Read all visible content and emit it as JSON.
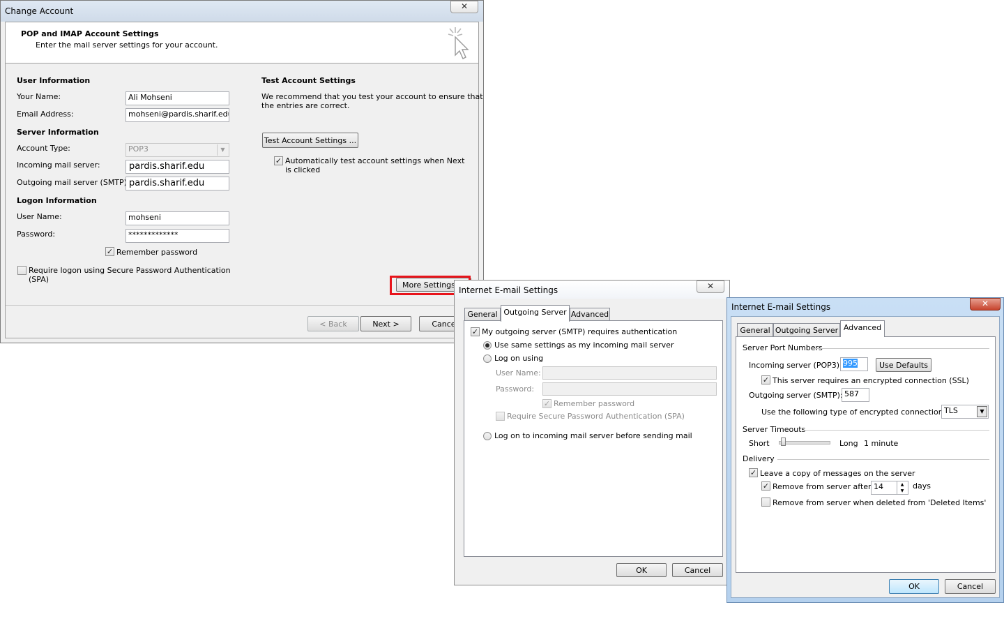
{
  "change_account": {
    "title": "Change Account",
    "close_glyph": "✕",
    "header_title": "POP and IMAP Account Settings",
    "header_subtitle": "Enter the mail server settings for your account.",
    "header_icon": "cursor-sparkle-icon",
    "user_info": {
      "heading": "User Information",
      "name_label": "Your Name:",
      "name_value": "Ali Mohseni",
      "email_label": "Email Address:",
      "email_value": "mohseni@pardis.sharif.edu"
    },
    "server_info": {
      "heading": "Server Information",
      "account_type_label": "Account Type:",
      "account_type_value": "POP3",
      "incoming_label": "Incoming mail server:",
      "incoming_value": "pardis.sharif.edu",
      "outgoing_label": "Outgoing mail server (SMTP):",
      "outgoing_value": "pardis.sharif.edu"
    },
    "logon_info": {
      "heading": "Logon Information",
      "username_label": "User Name:",
      "username_value": "mohseni",
      "password_label": "Password:",
      "password_value": "*************",
      "remember_label": "Remember password",
      "remember_checked": true,
      "spa_label_line1": "Require logon using Secure Password Authentication",
      "spa_label_line2": "(SPA)",
      "spa_checked": false
    },
    "test_settings": {
      "heading": "Test Account Settings",
      "desc_line1": "We recommend that you test your account to ensure that",
      "desc_line2": "the entries are correct.",
      "test_button": "Test Account Settings ...",
      "auto_test_line1": "Automatically test account settings when Next",
      "auto_test_line2": "is clicked",
      "auto_test_checked": true
    },
    "more_settings_button": "More Settings ...",
    "highlight_color": "#e8141b",
    "back_button": "< Back",
    "next_button": "Next >",
    "cancel_button": "Cancel"
  },
  "outgoing_dialog": {
    "title": "Internet E-mail Settings",
    "close_glyph": "✕",
    "tabs": [
      "General",
      "Outgoing Server",
      "Advanced"
    ],
    "selected_tab": "Outgoing Server",
    "smtp_auth_label": "My outgoing server (SMTP) requires authentication",
    "smtp_auth_checked": true,
    "same_settings_label": "Use same settings as my incoming mail server",
    "log_on_using_label": "Log on using",
    "username_label": "User Name:",
    "username_value": "",
    "password_label": "Password:",
    "password_value": "",
    "remember_label": "Remember password",
    "spa_label": "Require Secure Password Authentication (SPA)",
    "log_on_incoming_label": "Log on to incoming mail server before sending mail",
    "ok_button": "OK",
    "cancel_button": "Cancel"
  },
  "advanced_dialog": {
    "title": "Internet E-mail Settings",
    "close_glyph": "✕",
    "tabs": [
      "General",
      "Outgoing Server",
      "Advanced"
    ],
    "selected_tab": "Advanced",
    "ports_heading": "Server Port Numbers",
    "incoming_label": "Incoming server (POP3):",
    "incoming_value": "995",
    "use_defaults_button": "Use Defaults",
    "ssl_label": "This server requires an encrypted connection (SSL)",
    "ssl_checked": true,
    "outgoing_label": "Outgoing server (SMTP):",
    "outgoing_value": "587",
    "encryption_label": "Use the following type of encrypted connection:",
    "encryption_value": "TLS",
    "timeouts_heading": "Server Timeouts",
    "short_label": "Short",
    "long_label": "Long",
    "timeout_value": "1 minute",
    "timeout_level": 0.05,
    "delivery_heading": "Delivery",
    "leave_copy_label": "Leave a copy of messages on the server",
    "leave_copy_checked": true,
    "remove_after_label": "Remove from server after",
    "remove_after_checked": true,
    "remove_days_value": "14",
    "days_label": "days",
    "remove_deleted_label": "Remove from server when deleted from 'Deleted Items'",
    "remove_deleted_checked": false,
    "ok_button": "OK",
    "cancel_button": "Cancel"
  }
}
